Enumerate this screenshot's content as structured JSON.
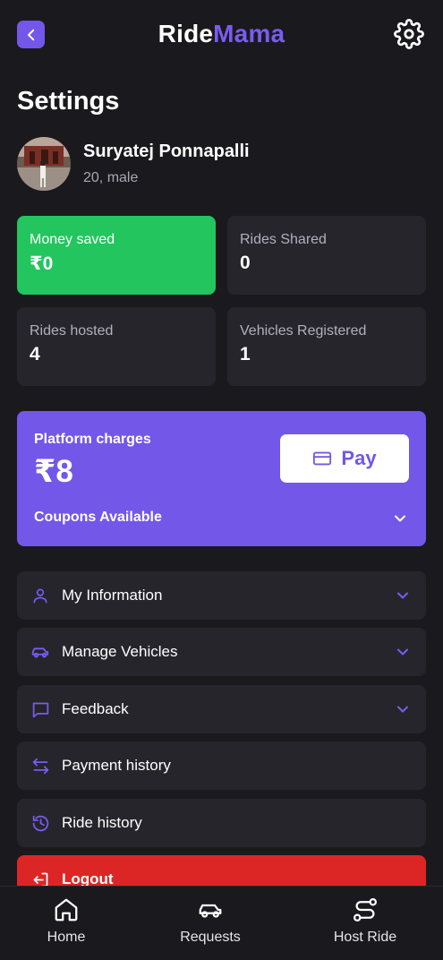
{
  "header": {
    "brand_part1": "Ride",
    "brand_part2": "Mama",
    "accent_color": "#7357e8"
  },
  "page_title": "Settings",
  "user": {
    "name": "Suryatej Ponnapalli",
    "meta": "20, male"
  },
  "stats": [
    {
      "label": "Money saved",
      "value": "₹0",
      "highlight_color": "#22c55e"
    },
    {
      "label": "Rides Shared",
      "value": "0"
    },
    {
      "label": "Rides hosted",
      "value": "4"
    },
    {
      "label": "Vehicles Registered",
      "value": "1"
    }
  ],
  "platform": {
    "title": "Platform charges",
    "amount": "₹8",
    "pay_label": "Pay",
    "coupons_label": "Coupons Available"
  },
  "menu": [
    {
      "label": "My Information",
      "icon": "user-icon"
    },
    {
      "label": "Manage Vehicles",
      "icon": "car-icon"
    },
    {
      "label": "Feedback",
      "icon": "message-icon"
    },
    {
      "label": "Payment history",
      "icon": "transfer-icon"
    },
    {
      "label": "Ride history",
      "icon": "history-icon"
    },
    {
      "label": "Logout",
      "icon": "logout-icon",
      "color": "#dc2626"
    }
  ],
  "nav": [
    {
      "label": "Home",
      "icon": "home-icon"
    },
    {
      "label": "Requests",
      "icon": "car-icon"
    },
    {
      "label": "Host Ride",
      "icon": "route-icon"
    }
  ]
}
